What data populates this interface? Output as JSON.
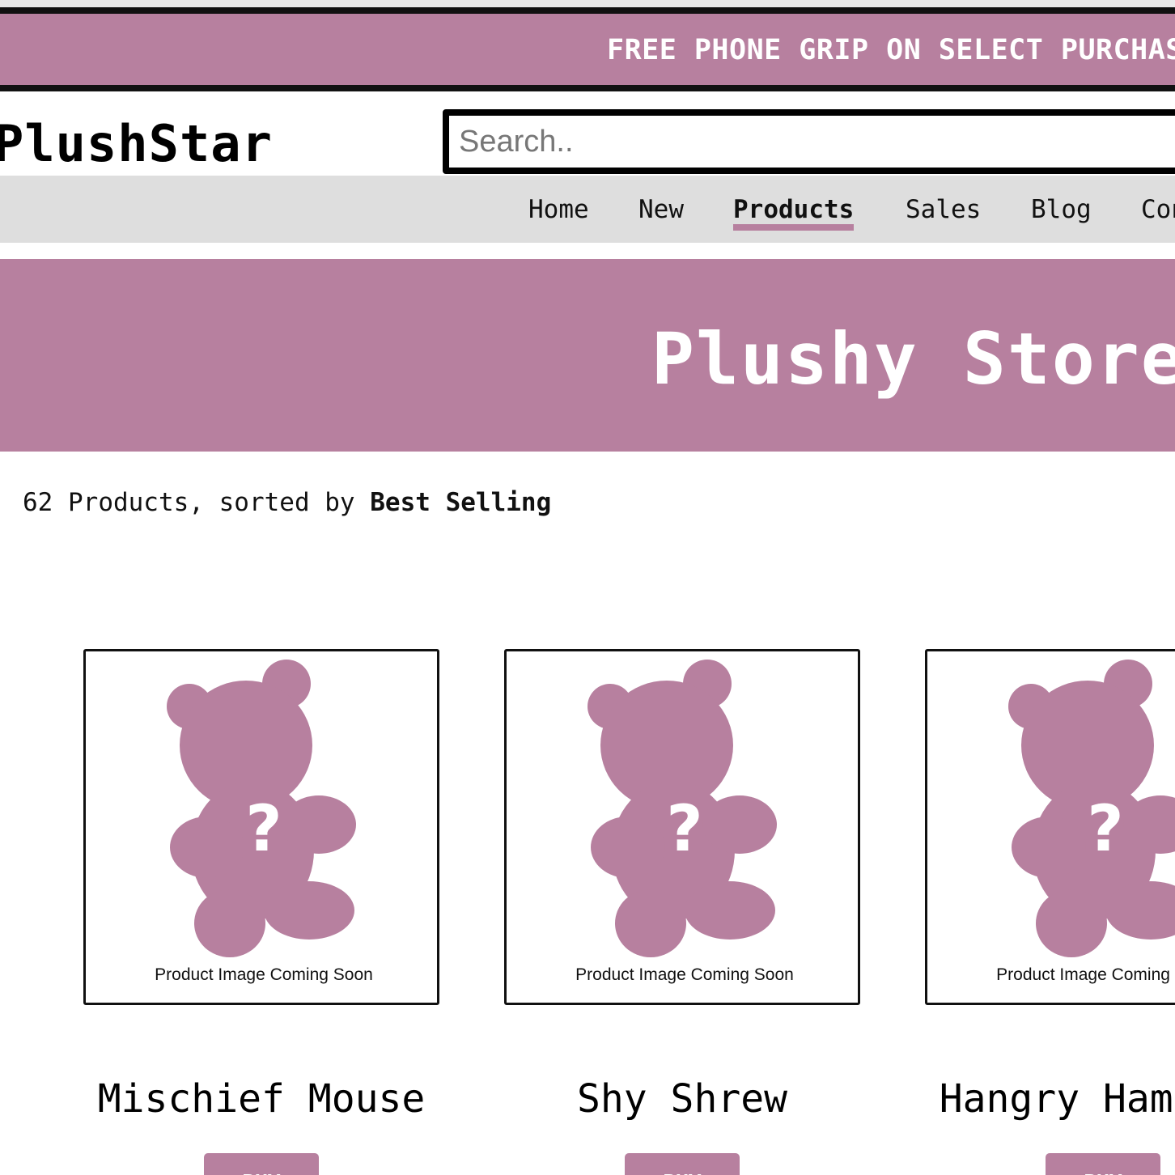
{
  "promo_banner": {
    "text": "FREE PHONE GRIP ON SELECT PURCHASES"
  },
  "header": {
    "logo": "PlushStar",
    "search_placeholder": "Search.."
  },
  "nav": {
    "items": [
      {
        "label": "Home",
        "active": false
      },
      {
        "label": "New",
        "active": false
      },
      {
        "label": "Products",
        "active": true
      },
      {
        "label": "Sales",
        "active": false
      },
      {
        "label": "Blog",
        "active": false
      },
      {
        "label": "Contact",
        "active": false
      }
    ]
  },
  "hero": {
    "title": "Plushy Store"
  },
  "listing": {
    "count_text": "62 Products, sorted by ",
    "sort_value": "Best Selling"
  },
  "products": [
    {
      "name": "Mischief Mouse",
      "image_caption": "Product Image Coming Soon",
      "button_label": "BUY"
    },
    {
      "name": "Shy Shrew",
      "image_caption": "Product Image Coming Soon",
      "button_label": "BUY"
    },
    {
      "name": "Hangry Hamster",
      "image_caption": "Product Image Coming Soon",
      "button_label": "BUY"
    }
  ],
  "colors": {
    "accent": "#b7809f",
    "nav_background": "#dedede",
    "text": "#111111"
  },
  "icons": {
    "placeholder_image": "teddy-bear-question-icon"
  }
}
